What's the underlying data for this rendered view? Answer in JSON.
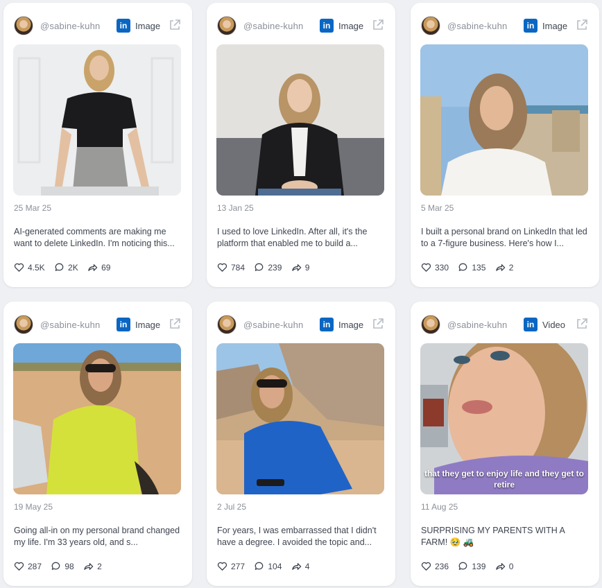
{
  "cards": [
    {
      "handle": "@sabine-kuhn",
      "network_icon": "linkedin-icon",
      "media_type": "Image",
      "date": "25 Mar 25",
      "text": "AI-generated comments are making me want to delete LinkedIn. I'm noticing this...",
      "likes": "4.5K",
      "comments": "2K",
      "shares": "69",
      "overlay": ""
    },
    {
      "handle": "@sabine-kuhn",
      "network_icon": "linkedin-icon",
      "media_type": "Image",
      "date": "13 Jan 25",
      "text": "I used to love LinkedIn. After all, it's the platform that enabled me to build a...",
      "likes": "784",
      "comments": "239",
      "shares": "9",
      "overlay": ""
    },
    {
      "handle": "@sabine-kuhn",
      "network_icon": "linkedin-icon",
      "media_type": "Image",
      "date": "5 Mar 25",
      "text": "I built a personal brand on LinkedIn that led to a 7-figure business. Here's how I...",
      "likes": "330",
      "comments": "135",
      "shares": "2",
      "overlay": ""
    },
    {
      "handle": "@sabine-kuhn",
      "network_icon": "linkedin-icon",
      "media_type": "Image",
      "date": "19 May 25",
      "text": "Going all-in on my personal brand changed my life. I'm 33 years old, and s...",
      "likes": "287",
      "comments": "98",
      "shares": "2",
      "overlay": ""
    },
    {
      "handle": "@sabine-kuhn",
      "network_icon": "linkedin-icon",
      "media_type": "Image",
      "date": "2 Jul 25",
      "text": "For years, I was embarrassed that I didn't have a degree.  I avoided the topic and...",
      "likes": "277",
      "comments": "104",
      "shares": "4",
      "overlay": ""
    },
    {
      "handle": "@sabine-kuhn",
      "network_icon": "linkedin-icon",
      "media_type": "Video",
      "date": "11 Aug 25",
      "text": "SURPRISING MY PARENTS WITH A FARM! 🥹 🚜",
      "likes": "236",
      "comments": "139",
      "shares": "0",
      "overlay": "that they get to enjoy life and they get to retire"
    }
  ],
  "theme": {
    "linkedin_blue": "#0a66c2",
    "muted_text": "#8a8f98",
    "body_text": "#3e4450",
    "background": "#eef0f3"
  }
}
